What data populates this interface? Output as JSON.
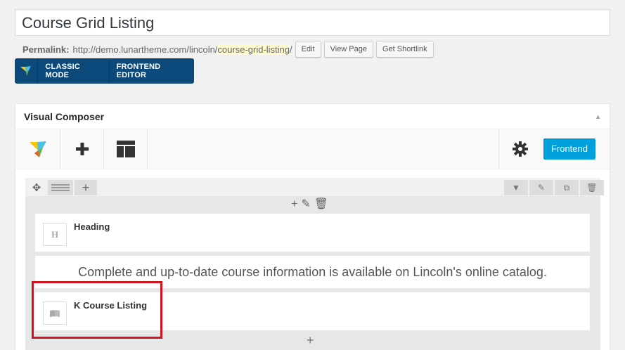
{
  "post_title": "Course Grid Listing",
  "permalink": {
    "label": "Permalink:",
    "base": "http://demo.lunartheme.com/lincoln/",
    "slug": "course-grid-listing",
    "trail": "/",
    "buttons": [
      "Edit",
      "View Page",
      "Get Shortlink"
    ]
  },
  "modes": {
    "classic": "CLASSIC MODE",
    "frontend": "FRONTEND EDITOR"
  },
  "vc": {
    "title": "Visual Composer",
    "frontend_button": "Frontend"
  },
  "elements": {
    "heading": {
      "label": "Heading",
      "icon_letter": "H"
    },
    "text": {
      "content": "Complete and up-to-date course information is available on Lincoln's online catalog."
    },
    "course": {
      "label": "K Course Listing"
    }
  },
  "colors": {
    "mode_bar": "#0b4a7a",
    "frontend": "#00a0dc",
    "highlight": "#d4141c"
  }
}
